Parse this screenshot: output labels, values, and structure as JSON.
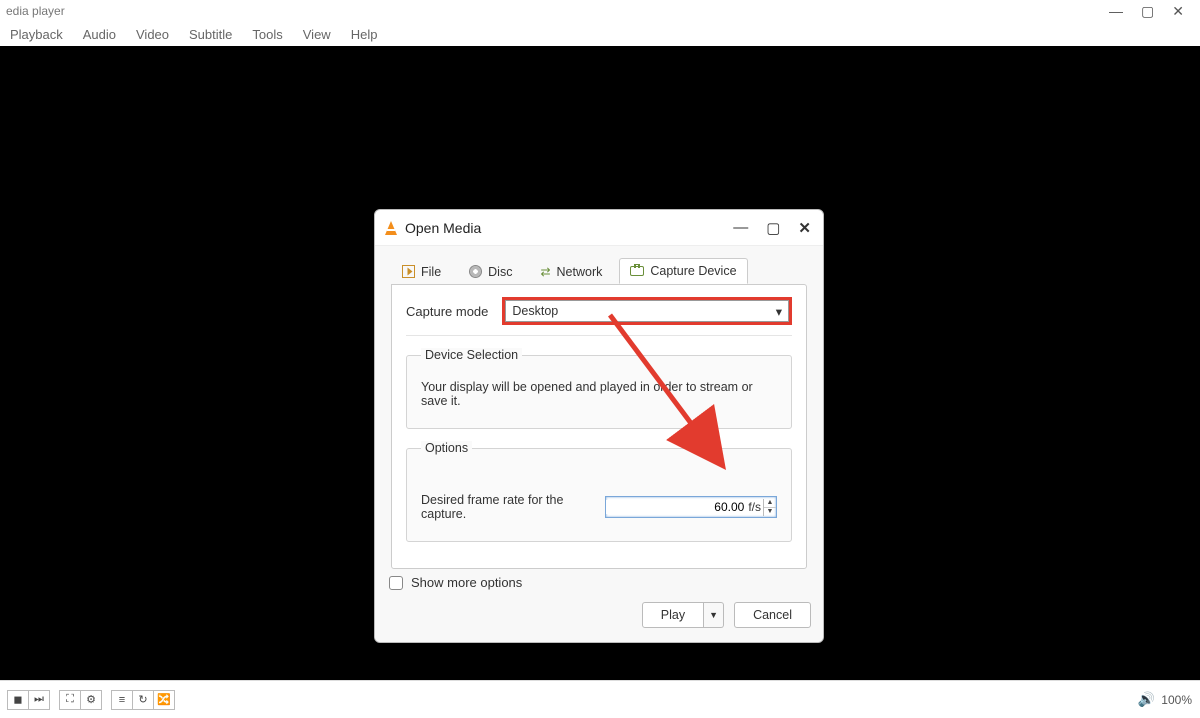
{
  "window": {
    "title": "edia player",
    "controls": {
      "min": "—",
      "max": "▢",
      "close": "✕"
    }
  },
  "menubar": [
    "Playback",
    "Audio",
    "Video",
    "Subtitle",
    "Tools",
    "View",
    "Help"
  ],
  "dialog": {
    "title": "Open Media",
    "tabs": [
      {
        "label": "File"
      },
      {
        "label": "Disc"
      },
      {
        "label": "Network"
      },
      {
        "label": "Capture Device",
        "active": true
      }
    ],
    "capture_mode_label": "Capture mode",
    "capture_mode_value": "Desktop",
    "device_selection_legend": "Device Selection",
    "device_selection_text": "Your display will be opened and played in order to stream or save it.",
    "options_legend": "Options",
    "frame_rate_label": "Desired frame rate for the capture.",
    "frame_rate_value": "60.00",
    "frame_rate_unit": "f/s",
    "show_more_label": "Show more options",
    "play_label": "Play",
    "cancel_label": "Cancel"
  },
  "statusbar": {
    "volume": "100%"
  },
  "annotation": {
    "color": "#e23b2e"
  }
}
